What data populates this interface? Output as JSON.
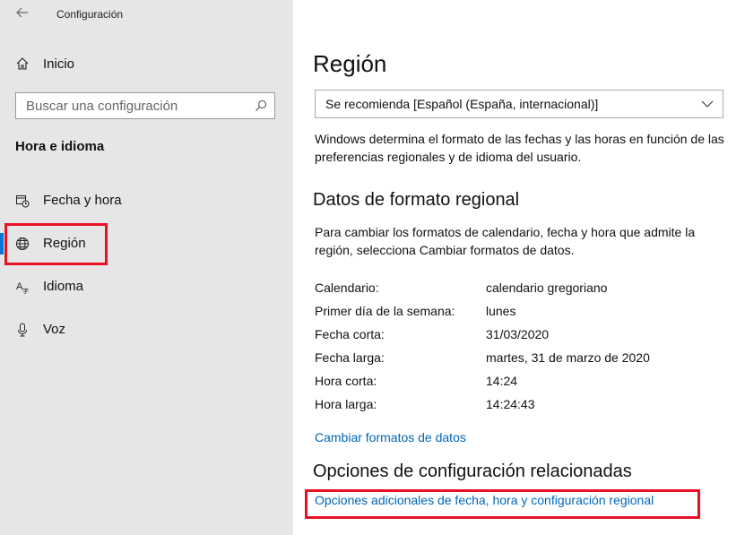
{
  "window": {
    "title": "Configuración"
  },
  "sidebar": {
    "home_label": "Inicio",
    "search_placeholder": "Buscar una configuración",
    "section_title": "Hora e idioma",
    "items": [
      {
        "label": "Fecha y hora",
        "icon": "calendar-clock-icon"
      },
      {
        "label": "Región",
        "icon": "globe-icon",
        "active": true
      },
      {
        "label": "Idioma",
        "icon": "language-icon"
      },
      {
        "label": "Voz",
        "icon": "microphone-icon"
      }
    ]
  },
  "main": {
    "title": "Región",
    "format_dropdown": {
      "value": "Se recomienda [Español (España, internacional)]"
    },
    "format_description": "Windows determina el formato de las fechas y las horas en función de las preferencias regionales y de idioma del usuario.",
    "regional_heading": "Datos de formato regional",
    "regional_description": "Para cambiar los formatos de calendario, fecha y hora que admite la región, selecciona Cambiar formatos de datos.",
    "format_rows": [
      {
        "key": "Calendario:",
        "value": "calendario gregoriano"
      },
      {
        "key": "Primer día de la semana:",
        "value": "lunes"
      },
      {
        "key": "Fecha corta:",
        "value": "31/03/2020"
      },
      {
        "key": "Fecha larga:",
        "value": "martes, 31 de marzo de 2020"
      },
      {
        "key": "Hora corta:",
        "value": "14:24"
      },
      {
        "key": "Hora larga:",
        "value": "14:24:43"
      }
    ],
    "change_formats_link": "Cambiar formatos de datos",
    "related_heading": "Opciones de configuración relacionadas",
    "related_link": "Opciones adicionales de fecha, hora y configuración regional"
  },
  "colors": {
    "accent": "#0078d7",
    "link": "#0067b8",
    "highlight": "#e81123",
    "sidebar_bg": "#e6e6e6"
  }
}
